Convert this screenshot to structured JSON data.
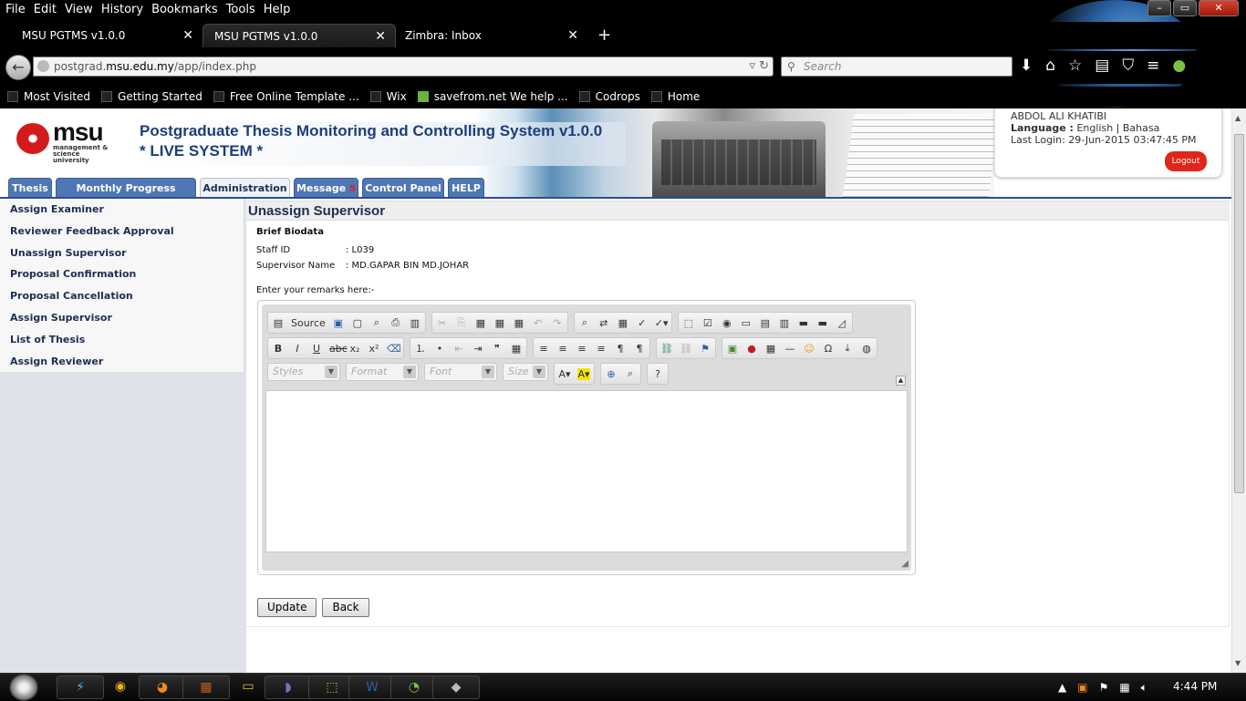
{
  "browser": {
    "menu": [
      "File",
      "Edit",
      "View",
      "History",
      "Bookmarks",
      "Tools",
      "Help"
    ],
    "tabs": [
      {
        "title": "MSU PGTMS v1.0.0"
      },
      {
        "title": "MSU PGTMS v1.0.0"
      },
      {
        "title": "Zimbra: Inbox"
      }
    ],
    "url_prefix": "postgrad.",
    "url_domain": "msu.edu.my",
    "url_path": "/app/index.php",
    "search_placeholder": "Search",
    "bookmarks": [
      "Most Visited",
      "Getting Started",
      "Free Online Template ...",
      "Wix",
      "savefrom.net We help ...",
      "Codrops",
      "Home"
    ]
  },
  "header": {
    "logo_word": "msu",
    "logo_sub1": "management &",
    "logo_sub2": "science university",
    "title_line1": "Postgraduate Thesis Monitoring and Controlling System v1.0.0",
    "title_line2": "* LIVE SYSTEM *",
    "user": {
      "name": "ABDOL ALI KHATIBI",
      "language_label": "Language :",
      "language_value": "English | Bahasa",
      "last_login": "Last Login: 29-Jun-2015 03:47:45 PM",
      "logout": "Logout"
    }
  },
  "nav_tabs": [
    {
      "label": "Thesis"
    },
    {
      "label": "Monthly Progress Report"
    },
    {
      "label": "Administration",
      "active": true
    },
    {
      "label": "Message",
      "badge": "5"
    },
    {
      "label": "Control Panel"
    },
    {
      "label": "HELP"
    }
  ],
  "sidebar": {
    "items": [
      {
        "label": "Assign Examiner"
      },
      {
        "label": "Reviewer Feedback Approval"
      },
      {
        "label": "Unassign Supervisor"
      },
      {
        "label": "Proposal Confirmation"
      },
      {
        "label": "Proposal Cancellation"
      },
      {
        "label": "Assign Supervisor"
      },
      {
        "label": "List of Thesis"
      },
      {
        "label": "Assign Reviewer"
      }
    ]
  },
  "main": {
    "heading": "Unassign Supervisor",
    "bio_title": "Brief Biodata",
    "staff_id_label": "Staff ID",
    "staff_id_value": ": L039",
    "supervisor_label": "Supervisor Name",
    "supervisor_value": ": MD.GAPAR BIN MD.JOHAR",
    "remarks_label": "Enter your remarks here:-",
    "editor": {
      "source_label": "Source",
      "styles": "Styles",
      "format": "Format",
      "font": "Font",
      "size": "Size",
      "content": ""
    },
    "update_button": "Update",
    "back_button": "Back"
  },
  "taskbar": {
    "clock": "4:44 PM"
  }
}
